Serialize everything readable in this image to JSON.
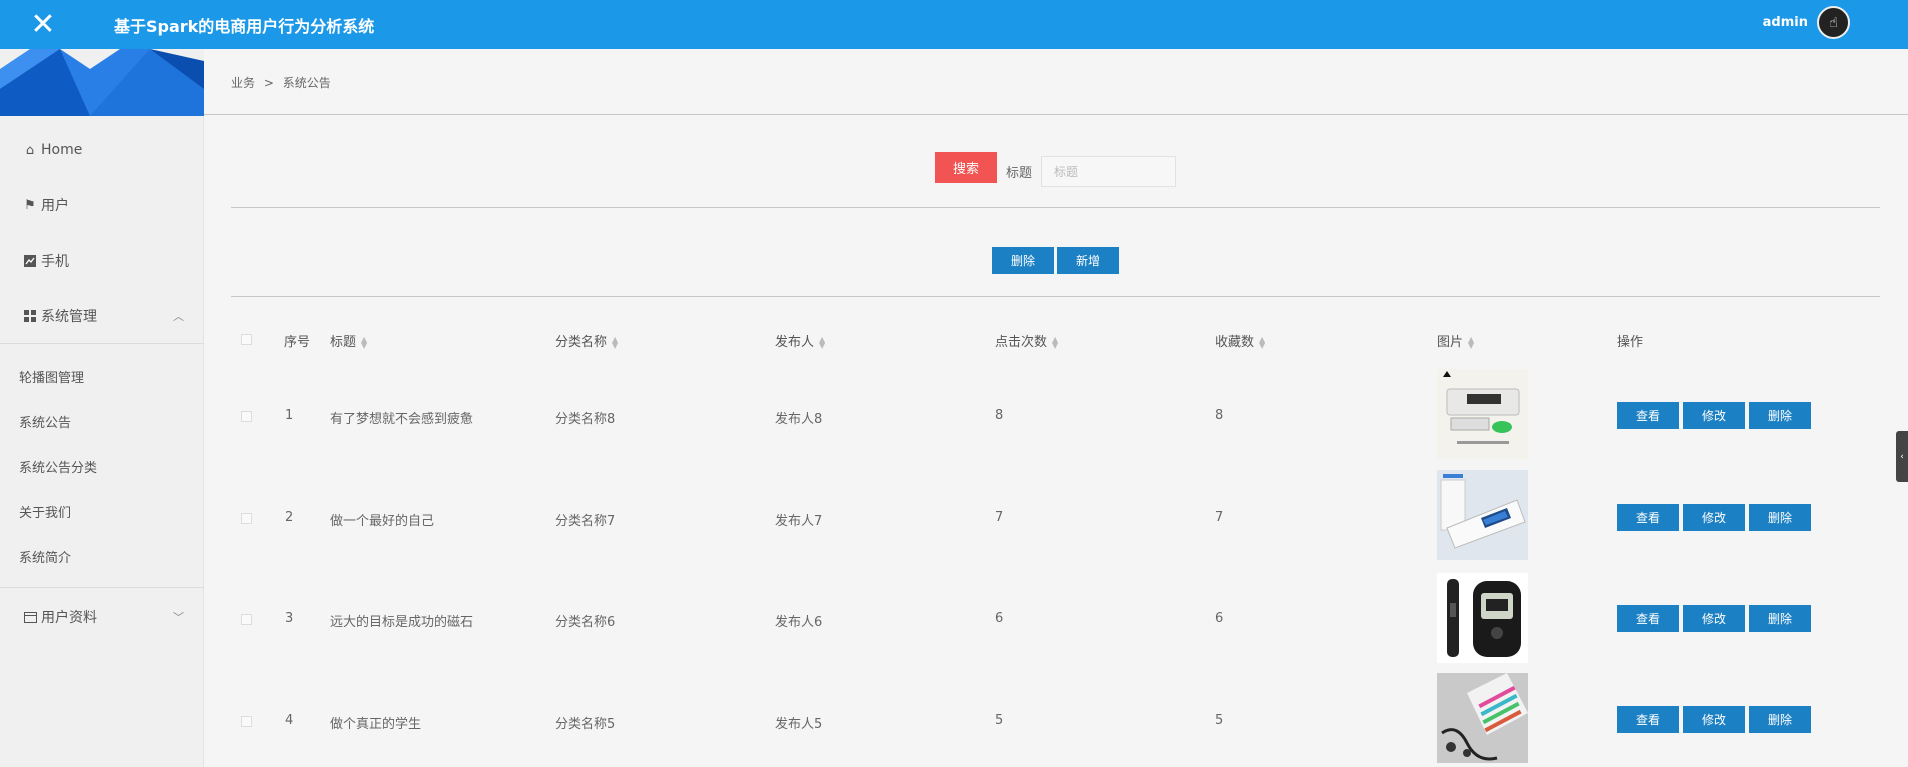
{
  "header": {
    "close_icon": "close-icon",
    "title": "基于Spark的电商用户行为分析系统",
    "user": "admin",
    "accent": "#1b98e8"
  },
  "sidebar": {
    "items": [
      {
        "label": "Home",
        "icon": "home-icon"
      },
      {
        "label": "用户",
        "icon": "flag-icon"
      },
      {
        "label": "手机",
        "icon": "chart-icon"
      },
      {
        "label": "系统管理",
        "icon": "grid-icon",
        "expanded": true
      }
    ],
    "sub_items": [
      "轮播图管理",
      "系统公告",
      "系统公告分类",
      "关于我们",
      "系统简介"
    ],
    "profile": {
      "label": "用户资料",
      "icon": "calendar-icon",
      "expanded": false
    }
  },
  "breadcrumb": {
    "root": "业务",
    "sep": ">",
    "current": "系统公告"
  },
  "search": {
    "button": "搜索",
    "label": "标题",
    "placeholder": "标题",
    "value": ""
  },
  "toolbar": {
    "delete": "删除",
    "add": "新增"
  },
  "table": {
    "headers": [
      "序号",
      "标题",
      "分类名称",
      "发布人",
      "点击次数",
      "收藏数",
      "图片",
      "操作"
    ],
    "rows": [
      {
        "no": "1",
        "title": "有了梦想就不会感到疲惫",
        "category": "分类名称8",
        "publisher": "发布人8",
        "clicks": "8",
        "favorites": "8"
      },
      {
        "no": "2",
        "title": "做一个最好的自己",
        "category": "分类名称7",
        "publisher": "发布人7",
        "clicks": "7",
        "favorites": "7"
      },
      {
        "no": "3",
        "title": "远大的目标是成功的磁石",
        "category": "分类名称6",
        "publisher": "发布人6",
        "clicks": "6",
        "favorites": "6"
      },
      {
        "no": "4",
        "title": "做个真正的学生",
        "category": "分类名称5",
        "publisher": "发布人5",
        "clicks": "5",
        "favorites": "5"
      }
    ],
    "actions": {
      "view": "查看",
      "edit": "修改",
      "delete": "删除"
    }
  },
  "colors": {
    "primary_button": "#1c80c4",
    "search_button": "#f25454"
  }
}
